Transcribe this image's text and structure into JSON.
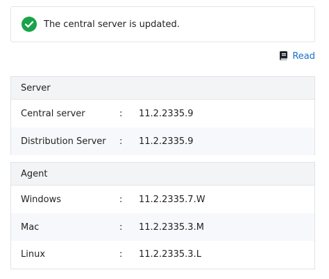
{
  "alert": {
    "message": "The central server is updated.",
    "icon": "check-circle-icon",
    "color": "#1aa34a"
  },
  "read_link": {
    "label": "Read",
    "icon": "book-icon",
    "color": "#1a6fc9"
  },
  "server": {
    "heading": "Server",
    "rows": [
      {
        "label": "Central server",
        "sep": ":",
        "value": "11.2.2335.9"
      },
      {
        "label": "Distribution Server",
        "sep": ":",
        "value": "11.2.2335.9"
      }
    ]
  },
  "agent": {
    "heading": "Agent",
    "rows": [
      {
        "label": "Windows",
        "sep": ":",
        "value": "11.2.2335.7.W"
      },
      {
        "label": "Mac",
        "sep": ":",
        "value": "11.2.2335.3.M"
      },
      {
        "label": "Linux",
        "sep": ":",
        "value": "11.2.2335.3.L"
      }
    ]
  }
}
